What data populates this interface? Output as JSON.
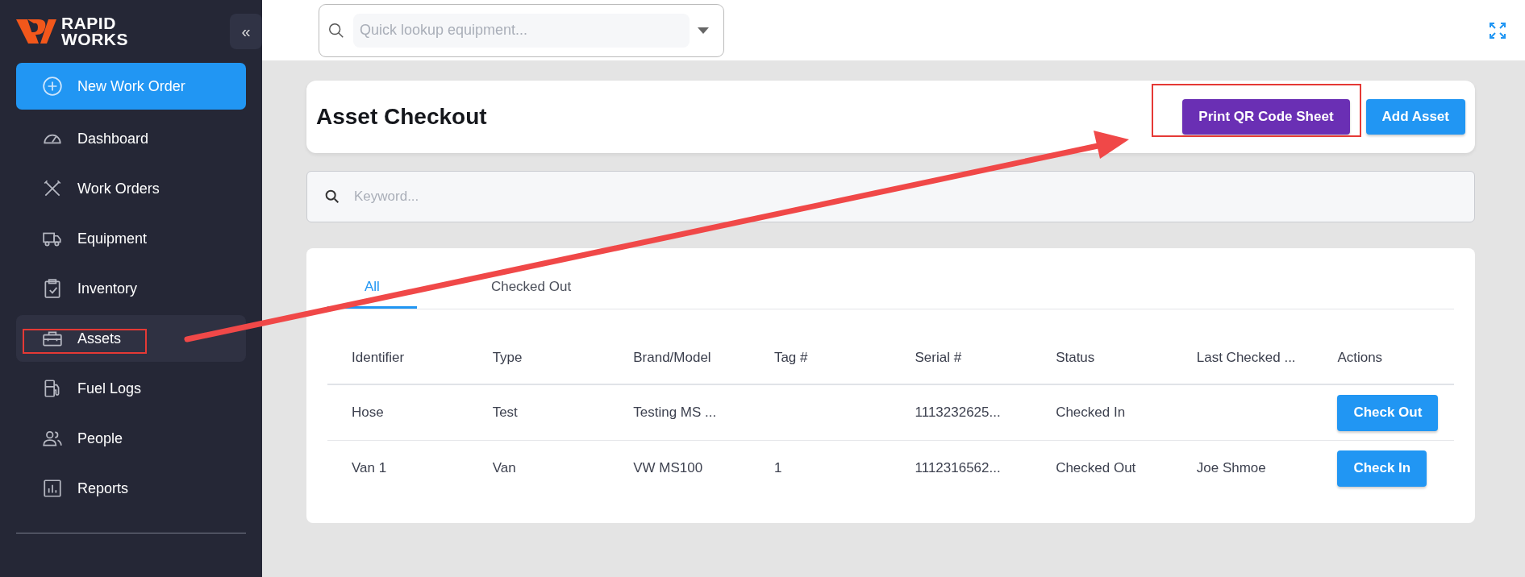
{
  "sidebar": {
    "brand": [
      "RAPID",
      "WORKS"
    ],
    "collapse": "«",
    "new_button": "New Work Order",
    "items": [
      {
        "label": "Dashboard",
        "selected": false
      },
      {
        "label": "Work Orders",
        "selected": false
      },
      {
        "label": "Equipment",
        "selected": false
      },
      {
        "label": "Inventory",
        "selected": false
      },
      {
        "label": "Assets",
        "selected": true
      },
      {
        "label": "Fuel Logs",
        "selected": false
      },
      {
        "label": "People",
        "selected": false
      },
      {
        "label": "Reports",
        "selected": false
      }
    ]
  },
  "top_bar": {
    "lookup": {
      "placeholder": "Quick lookup equipment..."
    }
  },
  "page": {
    "title": "Asset Checkout",
    "buttons": [
      {
        "label": "Print QR Code Sheet",
        "kind": "secondary"
      },
      {
        "label": "Add Asset",
        "kind": "primary"
      }
    ],
    "search": {
      "placeholder": "Keyword..."
    },
    "tabs": [
      {
        "label": "All",
        "selected": true
      },
      {
        "label": "Checked Out",
        "selected": false
      }
    ],
    "table": {
      "columns": [
        "Identifier",
        "Type",
        "Brand/Model",
        "Tag #",
        "Serial #",
        "Status",
        "Last Checked ...",
        "Actions"
      ],
      "rows": [
        {
          "cells": [
            "Hose",
            "Test",
            "Testing MS ...",
            "",
            "1113232625...",
            "Checked In",
            ""
          ],
          "action": "Check Out"
        },
        {
          "cells": [
            "Van 1",
            "Van",
            "VW MS100",
            "1",
            "1112316562...",
            "Checked Out",
            "Joe Shmoe"
          ],
          "action": "Check In"
        }
      ]
    }
  }
}
